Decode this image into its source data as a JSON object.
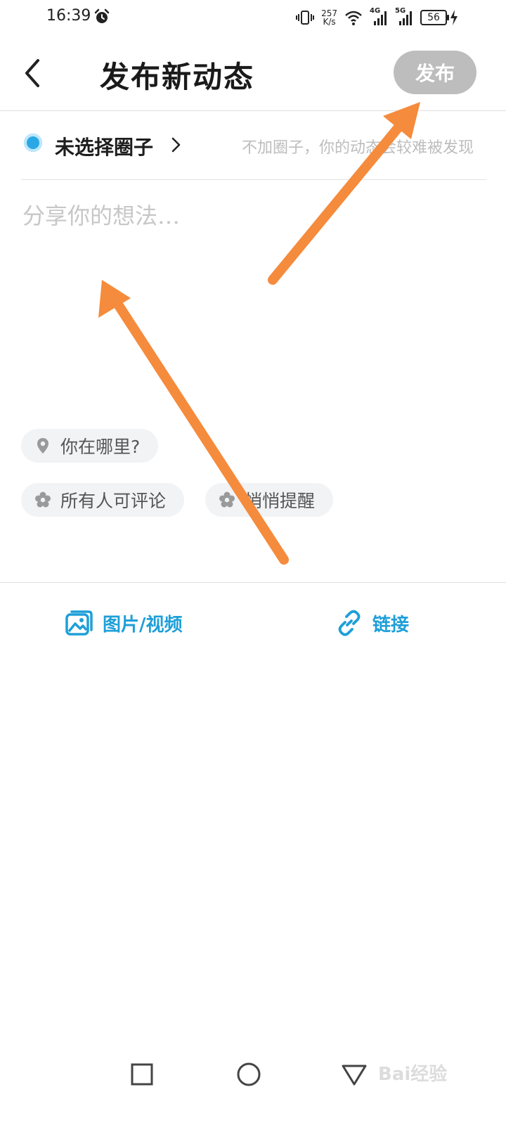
{
  "status_bar": {
    "time": "16:39",
    "network_speed_value": "257",
    "network_speed_unit": "K/s",
    "network_1": "4G",
    "network_2": "5G",
    "battery": "56",
    "icons": [
      "alarm-icon",
      "vibrate-icon",
      "wifi-icon",
      "signal-4g-icon",
      "signal-5g-icon",
      "battery-icon",
      "charging-icon"
    ]
  },
  "header": {
    "title": "发布新动态",
    "publish_label": "发布"
  },
  "circle": {
    "label": "未选择圈子",
    "hint": "不加圈子，你的动态会较难被发现"
  },
  "composer": {
    "placeholder": "分享你的想法…",
    "value": ""
  },
  "chips": {
    "location": "你在哪里?",
    "comment_permission": "所有人可评论",
    "remind": "悄悄提醒"
  },
  "attachments": {
    "media": "图片/视频",
    "link": "链接"
  },
  "watermark": {
    "text": "Bai经验"
  },
  "colors": {
    "accent": "#1e9fd8",
    "publish_disabled": "#bdbdbd",
    "arrow": "#f58b3c",
    "chip_bg": "#f1f3f5"
  }
}
